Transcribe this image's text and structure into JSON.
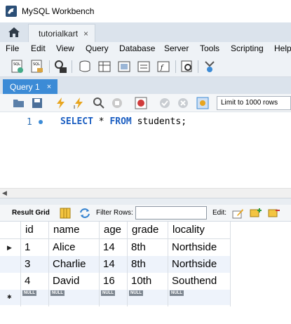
{
  "window": {
    "title": "MySQL Workbench"
  },
  "connection_tab": {
    "label": "tutorialkart",
    "close": "×"
  },
  "menu": [
    "File",
    "Edit",
    "View",
    "Query",
    "Database",
    "Server",
    "Tools",
    "Scripting",
    "Help"
  ],
  "query_tab": {
    "label": "Query 1",
    "close": "×"
  },
  "editor": {
    "line_number": "1",
    "tokens": {
      "select": "SELECT",
      "star": " * ",
      "from": "FROM",
      "rest": " students;"
    },
    "limit_option": "Limit to 1000 rows"
  },
  "result_toolbar": {
    "result_grid_label": "Result Grid",
    "filter_label": "Filter Rows:",
    "filter_value": "",
    "edit_label": "Edit:"
  },
  "grid": {
    "columns": [
      "id",
      "name",
      "age",
      "grade",
      "locality"
    ],
    "rows": [
      [
        "1",
        "Alice",
        "14",
        "8th",
        "Northside"
      ],
      [
        "3",
        "Charlie",
        "14",
        "8th",
        "Northside"
      ],
      [
        "4",
        "David",
        "16",
        "10th",
        "Southend"
      ]
    ],
    "null_label": "NULL",
    "current_row_marker": "▶",
    "new_row_marker": "✱"
  },
  "icons": {
    "app": "mysql-dolphin-icon",
    "home": "home-icon",
    "accent": "#3c8bd6",
    "keyword_color": "#1c5fc2"
  }
}
